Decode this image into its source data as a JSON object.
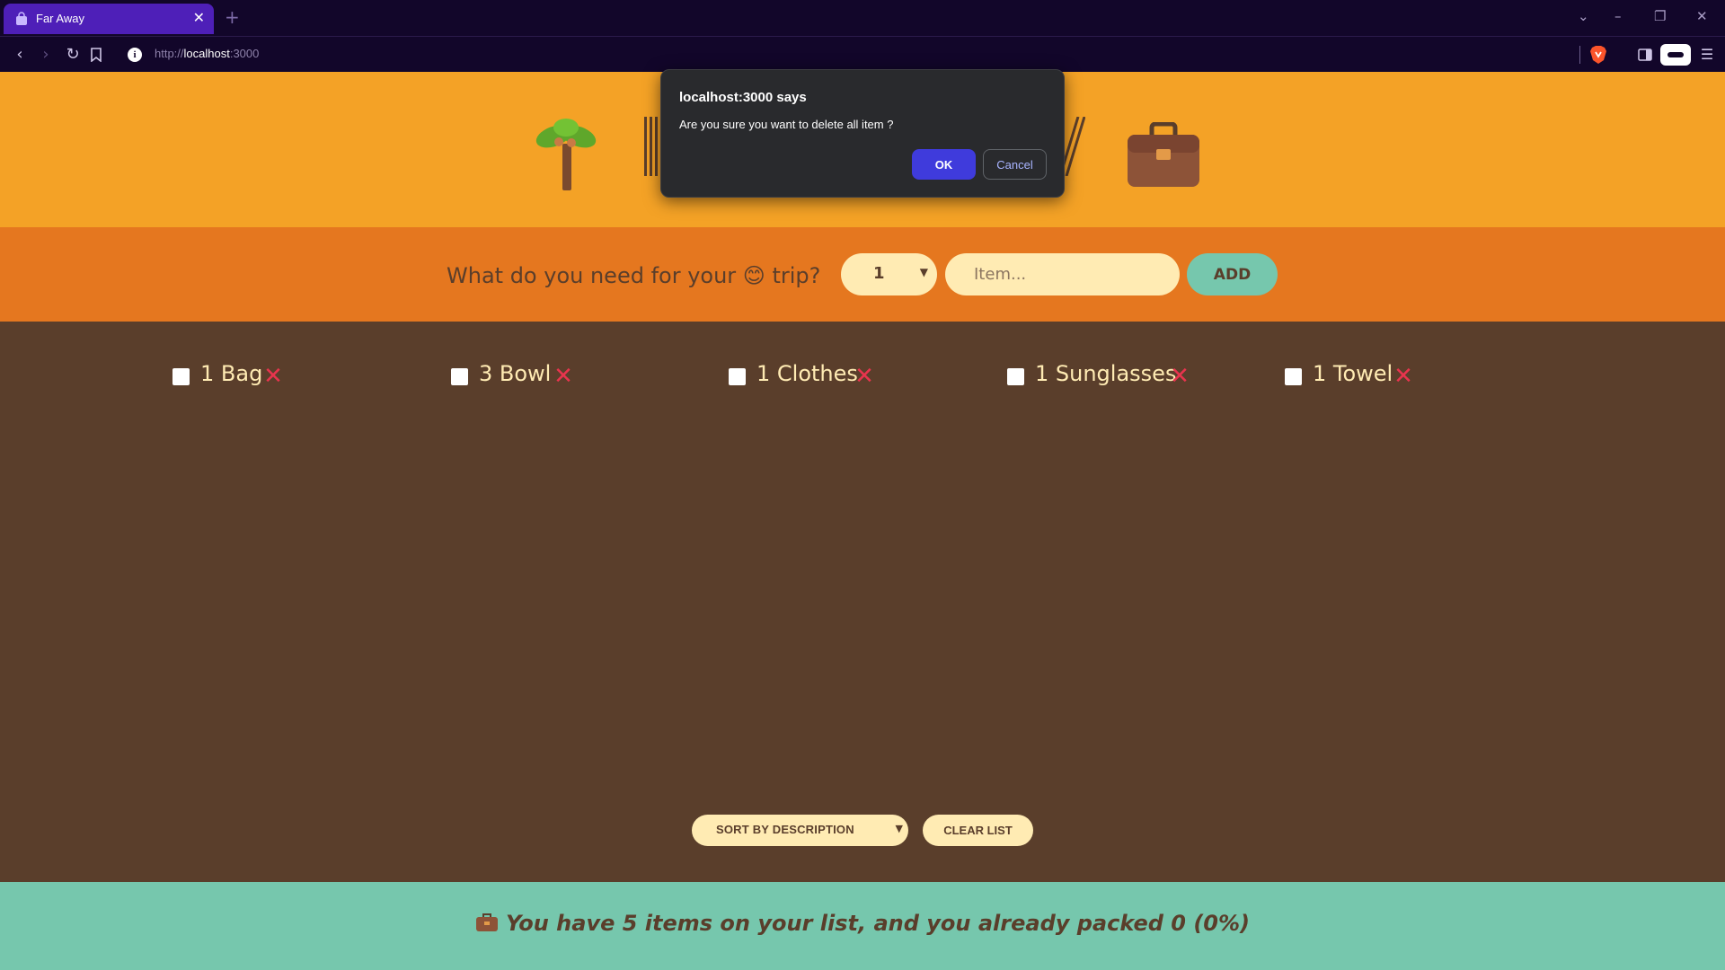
{
  "browser": {
    "tab_title": "Far Away",
    "tab_icon": "bag-icon",
    "new_tab_symbol": "+",
    "close_tab_symbol": "✕",
    "url_scheme": "http://",
    "url_host": "localhost",
    "url_port": ":3000",
    "window_controls": {
      "minimize": "–",
      "restore": "❐",
      "close": "✕",
      "tab_search": "⌄"
    }
  },
  "header": {
    "icons": [
      "palm-tree-icon",
      "briefcase-icon"
    ]
  },
  "form": {
    "question": "What do you need for your 😊 trip?",
    "quantity_value": "1",
    "item_placeholder": "Item...",
    "add_label": "ADD"
  },
  "items": [
    {
      "label": "1 Bag",
      "packed": false
    },
    {
      "label": "3 Bowl",
      "packed": false
    },
    {
      "label": "1 Clothes",
      "packed": false
    },
    {
      "label": "1 Sunglasses",
      "packed": false
    },
    {
      "label": "1 Towel",
      "packed": false
    }
  ],
  "actions": {
    "sort_selected": "SORT BY DESCRIPTION",
    "clear_label": "CLEAR LIST"
  },
  "stats": {
    "text": "You have 5 items on your list, and you already packed 0 (0%)",
    "icon": "briefcase-icon"
  },
  "dialog": {
    "title": "localhost:3000 says",
    "message": "Are you sure you want to delete all item ?",
    "ok_label": "OK",
    "cancel_label": "Cancel"
  },
  "colors": {
    "header_bg": "#f4a226",
    "form_bg": "#e5771f",
    "list_bg": "#5a3e2b",
    "stats_bg": "#76c7ad",
    "cream": "#ffebb3",
    "delete_red": "#e8344e",
    "dialog_ok": "#3f3bdc"
  }
}
